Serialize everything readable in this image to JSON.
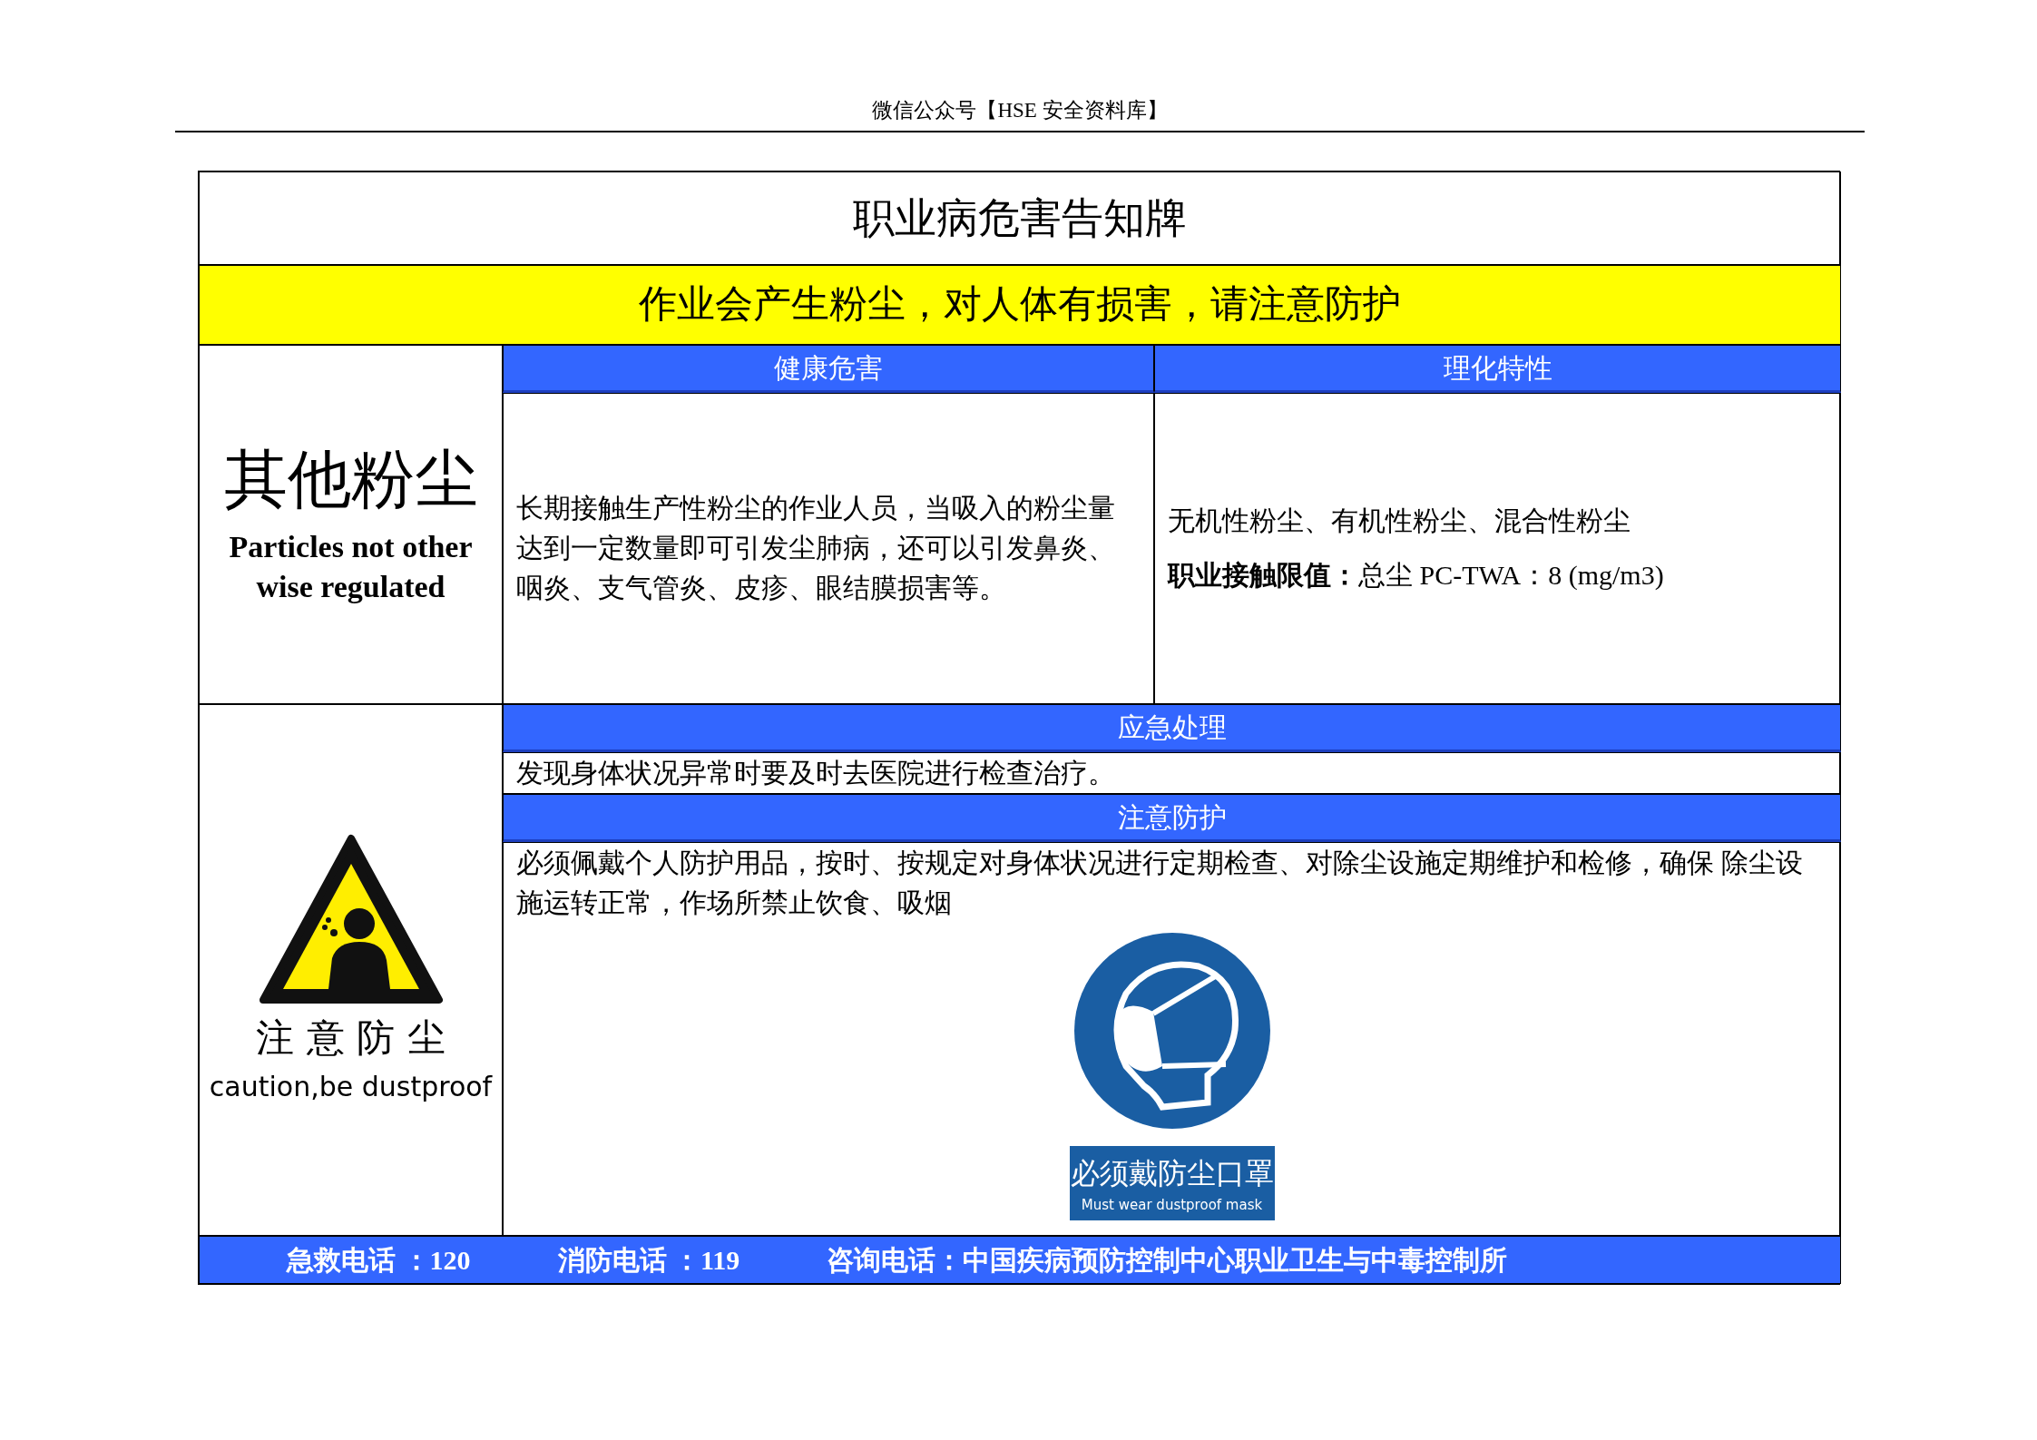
{
  "page_header": "微信公众号【HSE 安全资料库】",
  "title": "职业病危害告知牌",
  "warning_banner": "作业会产生粉尘，对人体有损害，请注意防护",
  "substance": {
    "name": "其他粉尘",
    "name_en": "Particles not other wise regulated"
  },
  "health_hazards": {
    "heading": "健康危害",
    "text": "长期接触生产性粉尘的作业人员，当吸入的粉尘量达到一定数量即可引发尘肺病，还可以引发鼻炎、咽炎、支气管炎、皮疹、眼结膜损害等。"
  },
  "properties": {
    "heading": "理化特性",
    "text": "无机性粉尘、有机性粉尘、混合性粉尘",
    "limit": "**职业接触限值：**总尘 PC-TWA：8 (mg/m3)"
  },
  "emergency": {
    "heading": "应急处理",
    "text": "发现身体状况异常时要及时去医院进行检查治疗。"
  },
  "protection": {
    "heading": "注意防护",
    "text": "必须佩戴个人防护用品，按时、按规定对身体状况进行定期检查、对除尘设施定期维护和检修，确保 除尘设施运转正常，作场所禁止饮食、吸烟"
  },
  "warning_sign": {
    "label": "注 意 防 尘",
    "label_en": "caution,be dustproof"
  },
  "mandatory_sign": {
    "label": "必须戴防尘口罩",
    "label_en": "Must wear dustproof mask"
  },
  "footer": [
    {
      "label": "急救电话 ：",
      "value": "120"
    },
    {
      "label": "消防电话 ：",
      "value": "119"
    },
    {
      "label": "咨询电话：",
      "value": "中国疾病预防控制中心职业卫生与中毒控制所"
    }
  ]
}
